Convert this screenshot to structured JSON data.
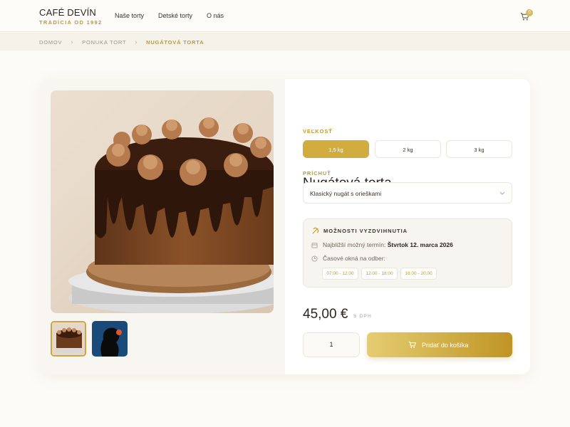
{
  "brand": {
    "name": "CAFÉ DEVÍN",
    "tagline": "TRADÍCIA OD 1992"
  },
  "nav": {
    "items": [
      "Naše torty",
      "Detské torty",
      "O nás"
    ]
  },
  "cart": {
    "count": "0",
    "icon": "cart-icon"
  },
  "breadcrumb": {
    "items": [
      "DOMOV",
      "PONUKA TORT",
      "NUGÁTOVÁ TORTA"
    ]
  },
  "product": {
    "title": "Nugátová torta",
    "size_label": "VEĽKOSŤ",
    "sizes": [
      "1,5 kg",
      "2 kg",
      "3 kg"
    ],
    "selected_size": "1,5 kg",
    "flavor_label": "PRÍCHUŤ",
    "flavor_value": "Klasický nugát s orieškami",
    "price": "45,00 €",
    "vat_note": "S DPH",
    "quantity": "1",
    "add_to_cart": "Pridať do košíka"
  },
  "pickup": {
    "title": "MOŽNOSTI VYZDVIHNUTIA",
    "earliest_prefix": "Najbližší možný termín:",
    "earliest_date": "Štvrtok 12. marca 2026",
    "windows_label": "Časové okná na odber:",
    "slots": [
      "07:00 - 12:00",
      "12:00 - 18:00",
      "18:00 - 20:00"
    ]
  },
  "colors": {
    "accent": "#d0ad3e",
    "accent_text": "#bf9a2e",
    "background": "#fcfbf7"
  }
}
